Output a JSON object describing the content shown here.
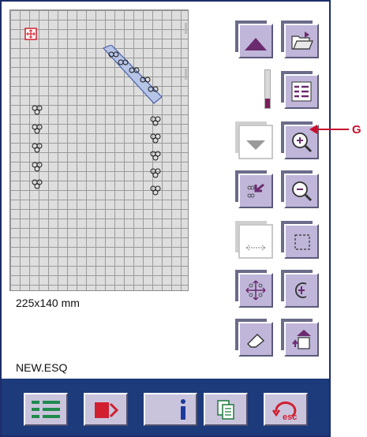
{
  "screen": {
    "dimensions_label": "225x140 mm",
    "file_name": "NEW.ESQ",
    "callout_label": "G"
  },
  "colors": {
    "accent_purple": "#6b3a8c",
    "button_face": "#bfb6d9",
    "bottom_bar": "#1d3a7a",
    "callout": "#c8102e"
  },
  "right_panel": {
    "slider_level": 0.25,
    "buttons": [
      {
        "name": "move-up-button",
        "icon": "triangle-up-icon",
        "enabled": true
      },
      {
        "name": "open-folder-button",
        "icon": "folder-open-icon",
        "enabled": true
      },
      {
        "name": "list-button",
        "icon": "list-icon",
        "enabled": true
      },
      {
        "name": "move-down-button",
        "icon": "triangle-down-icon",
        "enabled": false
      },
      {
        "name": "zoom-in-button",
        "icon": "zoom-in-icon",
        "enabled": true
      },
      {
        "name": "select-pointer-button",
        "icon": "pointer-select-icon",
        "enabled": true
      },
      {
        "name": "zoom-out-button",
        "icon": "zoom-out-icon",
        "enabled": true
      },
      {
        "name": "resize-horizontal-button",
        "icon": "resize-horizontal-icon",
        "enabled": false
      },
      {
        "name": "frame-button",
        "icon": "dashed-frame-icon",
        "enabled": true
      },
      {
        "name": "center-design-button",
        "icon": "center-move-icon",
        "enabled": true
      },
      {
        "name": "rotate-button",
        "icon": "rotate-icon",
        "enabled": true
      },
      {
        "name": "erase-button",
        "icon": "eraser-icon",
        "enabled": true
      },
      {
        "name": "layer-up-button",
        "icon": "layer-up-icon",
        "enabled": true
      }
    ]
  },
  "bottom_bar": {
    "buttons": [
      {
        "name": "menu-list-button",
        "icon": "menu-list-icon"
      },
      {
        "name": "machine-button",
        "icon": "machine-icon"
      },
      {
        "name": "info-button",
        "icon": "info-icon"
      },
      {
        "name": "copy-button",
        "icon": "copy-pages-icon"
      },
      {
        "name": "esc-button",
        "icon": "esc-return-icon"
      }
    ]
  }
}
